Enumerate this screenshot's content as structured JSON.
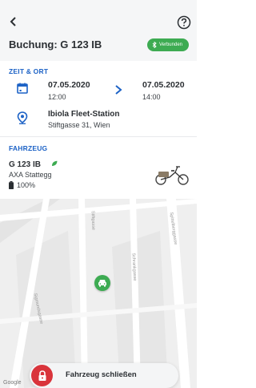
{
  "header": {
    "back_icon": "chevron-left-icon",
    "help_icon": "help-circle-icon",
    "title": "Buchung: G 123 IB",
    "connected_label": "Verbunden",
    "connected_color": "#3dab52"
  },
  "time_place": {
    "heading": "ZEIT & ORT",
    "from_date": "07.05.2020",
    "from_time": "12:00",
    "to_date": "07.05.2020",
    "to_time": "14:00",
    "station_name": "Ibiola Fleet-Station",
    "station_address": "Stiftgasse 31, Wien"
  },
  "vehicle": {
    "heading": "FAHRZEUG",
    "id": "G 123 IB",
    "model": "AXA Stattegg",
    "battery": "100%"
  },
  "map": {
    "street_labels": [
      "Sigmundsgasse",
      "Stiftgasse",
      "Schrankgasse",
      "Spittelberggasse"
    ],
    "attribution": "Google"
  },
  "action": {
    "lock_label": "Fahrzeug schließen",
    "lock_color": "#d9343b"
  },
  "colors": {
    "accent": "#1c62c6",
    "green": "#3dab52",
    "red": "#d9343b"
  }
}
